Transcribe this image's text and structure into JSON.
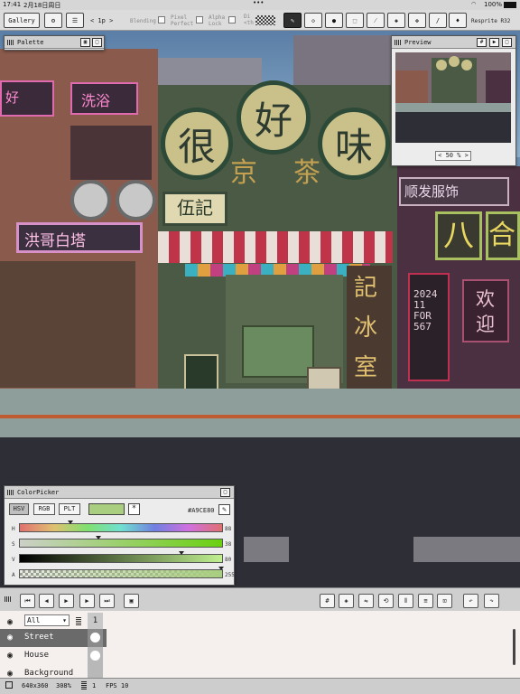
{
  "status_bar": {
    "time": "17:41",
    "date": "2月18日周日",
    "dots": "•••",
    "battery": "100%"
  },
  "toolbar": {
    "gallery": "Gallery",
    "frame": "< 1p >",
    "blending": "Blending",
    "pixel_perfect": "Pixel\nPerfect",
    "alpha_lock": "Alpha\nLock",
    "dither": "Di\n<th",
    "app_name": "Resprite R32"
  },
  "palette_panel": {
    "title": "Palette"
  },
  "preview_panel": {
    "title": "Preview",
    "zoom": "< 50 % >"
  },
  "color_picker": {
    "title": "ColorPicker",
    "modes": [
      "HSV",
      "RGB",
      "PLT"
    ],
    "hex": "#A9CE80",
    "current_color": "#A9CE80",
    "channels": [
      {
        "label": "H",
        "value": "88",
        "level": 0.24
      },
      {
        "label": "S",
        "value": "38",
        "level": 0.38
      },
      {
        "label": "V",
        "value": "80",
        "level": 0.8
      },
      {
        "label": "A",
        "value": "255",
        "level": 1.0
      }
    ]
  },
  "layers": {
    "filter": "All",
    "frame_number": "1",
    "items": [
      "Street",
      "House",
      "Background"
    ]
  },
  "footer": {
    "size": "640x360",
    "zoom": "308%",
    "frame": "1",
    "fps": "FPS 10"
  },
  "scene": {
    "signs": [
      "很",
      "好",
      "味",
      "京",
      "茶",
      "伍記",
      "洪哥白塔",
      "洗浴",
      "顺发服饰",
      "八",
      "合",
      "記",
      "冰",
      "室",
      "欢",
      "迎",
      "2024 11 FOR 567"
    ]
  }
}
